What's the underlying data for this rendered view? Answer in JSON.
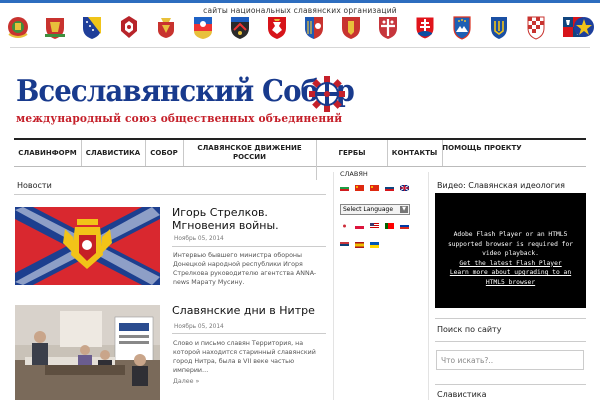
{
  "header": {
    "top_title": "сайты национальных славянских организаций",
    "emblem_icons": [
      "belarus-emblem-icon",
      "bulgaria-emblem-icon",
      "bosnia-emblem-icon",
      "macedonia-emblem-icon",
      "montenegro-emblem-icon",
      "lusatia-emblem-icon",
      "donetsk-emblem-icon",
      "poland-emblem-icon",
      "rusyn-emblem-icon",
      "ukraine-emblem-icon",
      "serbia-emblem-icon",
      "slovakia-emblem-icon",
      "slovenia-emblem-icon",
      "ukraine-trident-emblem-icon",
      "croatia-emblem-icon",
      "czech-emblem-icon",
      "slavic-union-emblem-icon"
    ],
    "site_title": "Всеславянский Собор",
    "site_subtitle": "международный союз общественных объединений"
  },
  "nav": {
    "items": [
      "СЛАВИНФОРМ",
      "СЛАВИСТИКА",
      "СОБОР",
      "СЛАВЯНСКОЕ ДВИЖЕНИЕ РОССИИ",
      "ГЕРБЫ",
      "КОНТАКТЫ",
      "ПОМОЩЬ ПРОЕКТУ"
    ]
  },
  "left": {
    "section_title": "Новости",
    "posts": [
      {
        "title": "Игорь Стрелков. Мгновения войны.",
        "date": "Ноябрь 05, 2014",
        "excerpt": "Интервью бывшего министра обороны Донецкой народной республики Игоря Стрелкова руководителю агентства ANNA-news Марату Мусину."
      },
      {
        "title": "Славянские дни в Нитре",
        "date": "Ноябрь 05, 2014",
        "excerpt": "Слово и письмо славян Территория, на которой находится  старинный славянский город Нитра, была в VII веке  частью империи…",
        "more": "Далее »"
      }
    ]
  },
  "middle": {
    "title": "СЛАВЯН",
    "language_select": "Select Language"
  },
  "sidebar": {
    "video_title": "Видео: Славянская идеология",
    "video_message": "Adobe Flash Player or an HTML5 supported browser is required for video playback.",
    "video_link_1": "Get the latest Flash Player",
    "video_link_2": "Learn more about upgrading to an HTML5 browser",
    "search_title": "Поиск по сайту",
    "search_placeholder": "Что искать?..",
    "slavistika_title": "Славистика"
  },
  "colors": {
    "title_blue": "#183a8d",
    "subtitle_red": "#c5202a",
    "top_accent": "#2d6dbf"
  }
}
